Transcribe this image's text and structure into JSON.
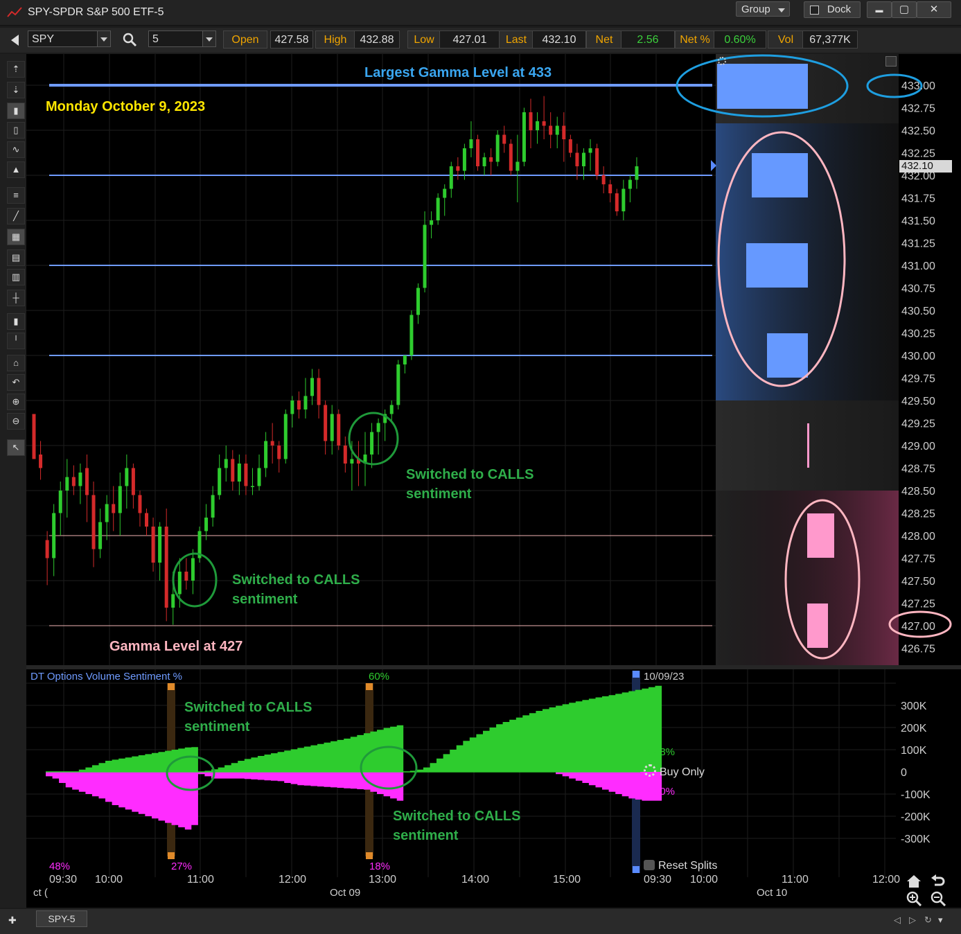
{
  "window": {
    "title": "SPY-SPDR S&P 500 ETF-5",
    "group_label": "Group",
    "dock_label": "Dock",
    "minimize_glyph": "▬",
    "maximize_glyph": "▢",
    "close_glyph": "✕"
  },
  "toolbar": {
    "symbol": "SPY",
    "interval": "5",
    "quote": [
      {
        "label": "Open",
        "value": "427.58"
      },
      {
        "label": "High",
        "value": "432.88"
      },
      {
        "label": "Low",
        "value": "427.01"
      },
      {
        "label": "Last",
        "value": "432.10"
      },
      {
        "label": "Net",
        "value": "2.56"
      },
      {
        "label": "Net %",
        "value": "0.60%"
      },
      {
        "label": "Vol",
        "value": "67,377K"
      }
    ]
  },
  "left_tools": [
    "cursor-icon",
    "crosshair-icon",
    "candle-icon",
    "bar-icon",
    "line-icon",
    "mountain-icon",
    "hline-icon",
    "trendline-icon",
    "grid-icon",
    "table-icon",
    "table2-icon",
    "vline-icon",
    "plus-bar-icon",
    "minus-bar-icon",
    "home-icon",
    "undo-icon",
    "zoom-in-icon",
    "zoom-out-icon",
    "pointer-icon"
  ],
  "main_chart": {
    "annotations": {
      "largest_gamma": "Largest Gamma Level at 433",
      "date": "Monday October 9, 2023",
      "calls_1_line1": "Switched to CALLS",
      "calls_1_line2": "sentiment",
      "calls_2_line1": "Switched to CALLS",
      "calls_2_line2": "sentiment",
      "gamma_427": "Gamma Level at 427"
    },
    "last_price_label": "432.10",
    "price_ticks": [
      "433.00",
      "432.75",
      "432.50",
      "432.25",
      "432.00",
      "431.75",
      "431.50",
      "431.25",
      "431.00",
      "430.75",
      "430.50",
      "430.25",
      "430.00",
      "429.75",
      "429.50",
      "429.25",
      "429.00",
      "428.75",
      "428.50",
      "428.25",
      "428.00",
      "427.75",
      "427.50",
      "427.25",
      "427.00",
      "426.75"
    ],
    "gamma_lines": {
      "blue": [
        433.0,
        432.0,
        431.0,
        430.0
      ],
      "pink": [
        428.0,
        427.0
      ]
    },
    "colors": {
      "up": "#2ecc2e",
      "down": "#d42a2a",
      "blue_line": "#6f9bff",
      "pink_line": "#f2b5b5",
      "gamma_blue": "#6699ff",
      "gamma_pink": "#ff99cc"
    }
  },
  "chart_data": [
    {
      "type": "candlestick",
      "title": "SPY-SPDR S&P 500 ETF-5",
      "ylim": [
        426.625,
        433.3
      ],
      "ohlc": [
        [
          429.35,
          429.35,
          428.85,
          428.85
        ],
        [
          428.9,
          429.05,
          428.62,
          428.75
        ],
        [
          427.95,
          428.05,
          427.45,
          427.75
        ],
        [
          427.75,
          428.35,
          427.55,
          428.25
        ],
        [
          428.25,
          428.6,
          428.0,
          428.5
        ],
        [
          428.5,
          428.85,
          428.2,
          428.65
        ],
        [
          428.65,
          428.78,
          428.45,
          428.55
        ],
        [
          428.55,
          428.8,
          428.35,
          428.7
        ],
        [
          428.75,
          428.9,
          428.15,
          428.45
        ],
        [
          428.45,
          428.6,
          427.65,
          427.85
        ],
        [
          427.85,
          428.3,
          427.75,
          428.15
        ],
        [
          428.15,
          428.45,
          427.95,
          428.35
        ],
        [
          428.35,
          428.55,
          428.05,
          428.25
        ],
        [
          428.25,
          428.7,
          428.0,
          428.55
        ],
        [
          428.55,
          428.9,
          428.3,
          428.75
        ],
        [
          428.75,
          428.8,
          428.3,
          428.45
        ],
        [
          428.45,
          428.5,
          428.1,
          428.25
        ],
        [
          428.25,
          428.3,
          428.0,
          428.1
        ],
        [
          428.1,
          428.2,
          427.6,
          427.7
        ],
        [
          427.7,
          428.15,
          427.5,
          428.1
        ],
        [
          428.1,
          428.3,
          427.05,
          427.2
        ],
        [
          427.2,
          427.6,
          427.01,
          427.35
        ],
        [
          427.35,
          427.75,
          427.2,
          427.6
        ],
        [
          427.6,
          427.75,
          427.4,
          427.5
        ],
        [
          427.5,
          427.85,
          427.35,
          427.75
        ],
        [
          427.75,
          428.1,
          427.7,
          428.05
        ],
        [
          428.05,
          428.35,
          427.95,
          428.2
        ],
        [
          428.2,
          428.55,
          428.1,
          428.45
        ],
        [
          428.45,
          428.9,
          428.4,
          428.75
        ],
        [
          428.75,
          429.0,
          428.6,
          428.85
        ],
        [
          428.85,
          428.95,
          428.5,
          428.6
        ],
        [
          428.6,
          428.9,
          428.45,
          428.8
        ],
        [
          428.8,
          428.9,
          428.45,
          428.55
        ],
        [
          428.55,
          428.75,
          428.45,
          428.55
        ],
        [
          428.55,
          428.9,
          428.5,
          428.75
        ],
        [
          428.75,
          429.15,
          428.65,
          429.05
        ],
        [
          429.05,
          429.25,
          428.8,
          429.0
        ],
        [
          429.0,
          429.05,
          428.7,
          428.85
        ],
        [
          428.85,
          429.4,
          428.8,
          429.35
        ],
        [
          429.35,
          429.55,
          429.2,
          429.5
        ],
        [
          429.5,
          429.6,
          429.3,
          429.4
        ],
        [
          429.4,
          429.75,
          429.3,
          429.55
        ],
        [
          429.55,
          429.85,
          429.45,
          429.75
        ],
        [
          429.75,
          429.85,
          429.3,
          429.45
        ],
        [
          429.45,
          429.5,
          428.9,
          429.05
        ],
        [
          429.05,
          429.45,
          428.9,
          429.35
        ],
        [
          429.35,
          429.4,
          428.95,
          429.0
        ],
        [
          429.0,
          429.1,
          428.7,
          428.8
        ],
        [
          428.8,
          429.05,
          428.5,
          428.85
        ],
        [
          428.85,
          429.05,
          428.55,
          428.8
        ],
        [
          428.8,
          429.15,
          428.55,
          428.9
        ],
        [
          428.9,
          429.25,
          428.75,
          429.15
        ],
        [
          429.15,
          429.3,
          428.9,
          429.25
        ],
        [
          429.25,
          429.4,
          429.05,
          429.35
        ],
        [
          429.35,
          429.5,
          429.25,
          429.45
        ],
        [
          429.45,
          429.95,
          429.4,
          429.9
        ],
        [
          429.9,
          430.0,
          429.8,
          430.0
        ],
        [
          430.0,
          430.5,
          429.95,
          430.45
        ],
        [
          430.45,
          430.8,
          430.35,
          430.75
        ],
        [
          430.75,
          431.6,
          430.7,
          431.45
        ],
        [
          431.45,
          431.6,
          431.3,
          431.5
        ],
        [
          431.5,
          431.8,
          431.45,
          431.75
        ],
        [
          431.75,
          431.9,
          431.55,
          431.85
        ],
        [
          431.85,
          432.15,
          431.75,
          432.1
        ],
        [
          432.1,
          432.2,
          431.95,
          432.05
        ],
        [
          432.05,
          432.35,
          431.95,
          432.3
        ],
        [
          432.3,
          432.6,
          432.2,
          432.4
        ],
        [
          432.4,
          432.45,
          432.05,
          432.1
        ],
        [
          432.1,
          432.25,
          432.0,
          432.2
        ],
        [
          432.2,
          432.3,
          432.0,
          432.15
        ],
        [
          432.15,
          432.5,
          432.1,
          432.45
        ],
        [
          432.45,
          432.55,
          432.25,
          432.35
        ],
        [
          432.35,
          432.4,
          432.0,
          432.05
        ],
        [
          432.05,
          432.45,
          431.7,
          432.15
        ],
        [
          432.15,
          432.75,
          432.1,
          432.7
        ],
        [
          432.7,
          432.85,
          432.3,
          432.5
        ],
        [
          432.5,
          432.7,
          432.35,
          432.6
        ],
        [
          432.6,
          432.88,
          432.4,
          432.55
        ],
        [
          432.55,
          432.7,
          432.3,
          432.45
        ],
        [
          432.45,
          432.65,
          432.3,
          432.55
        ],
        [
          432.55,
          432.7,
          432.15,
          432.4
        ],
        [
          432.4,
          432.45,
          432.2,
          432.25
        ],
        [
          432.25,
          432.35,
          431.95,
          432.1
        ],
        [
          432.1,
          432.3,
          431.95,
          432.25
        ],
        [
          432.25,
          432.4,
          432.05,
          432.3
        ],
        [
          432.3,
          432.35,
          431.95,
          432.0
        ],
        [
          432.0,
          432.1,
          431.8,
          431.9
        ],
        [
          431.9,
          431.95,
          431.7,
          431.8
        ],
        [
          431.8,
          431.85,
          431.55,
          431.6
        ],
        [
          431.6,
          431.95,
          431.5,
          431.85
        ],
        [
          431.85,
          432.0,
          431.7,
          431.95
        ],
        [
          431.95,
          432.2,
          431.85,
          432.1
        ]
      ]
    },
    {
      "type": "area",
      "title": "DT Options Volume Sentiment %",
      "ylim": [
        -350000,
        350000
      ],
      "yticks": [
        "300K",
        "200K",
        "100K",
        "0",
        "-100K",
        "-200K",
        "-300K"
      ],
      "series": [
        {
          "name": "B-48%",
          "color": "#2ecc2e",
          "values": [
            0,
            0,
            0,
            0,
            0,
            10000,
            20000,
            30000,
            40000,
            50000,
            55000,
            60000,
            65000,
            70000,
            75000,
            80000,
            85000,
            90000,
            95000,
            100000,
            105000,
            110000,
            112000,
            0,
            5000,
            12000,
            20000,
            30000,
            40000,
            50000,
            58000,
            65000,
            72000,
            78000,
            84000,
            90000,
            96000,
            102000,
            108000,
            114000,
            120000,
            126000,
            132000,
            138000,
            144000,
            150000,
            158000,
            166000,
            174000,
            182000,
            190000,
            198000,
            204000,
            210000,
            0,
            5000,
            10000,
            20000,
            40000,
            60000,
            80000,
            100000,
            120000,
            140000,
            155000,
            170000,
            185000,
            200000,
            215000,
            225000,
            235000,
            245000,
            255000,
            265000,
            275000,
            283000,
            291000,
            298000,
            305000,
            312000,
            318000,
            324000,
            330000,
            336000,
            341000,
            346000,
            352000,
            358000,
            364000,
            370000,
            376000,
            382000,
            388000
          ]
        },
        {
          "name": "B-30%",
          "color": "#ff2cff",
          "values": [
            -20000,
            -30000,
            -50000,
            -70000,
            -80000,
            -90000,
            -100000,
            -110000,
            -120000,
            -135000,
            -150000,
            -160000,
            -170000,
            -180000,
            -190000,
            -200000,
            -210000,
            -220000,
            -230000,
            -240000,
            -250000,
            -260000,
            -240000,
            -10000,
            -20000,
            -30000,
            -30000,
            -30000,
            -30000,
            -30000,
            -32000,
            -34000,
            -36000,
            -38000,
            -40000,
            -42000,
            -50000,
            -55000,
            -60000,
            -62000,
            -64000,
            -66000,
            -68000,
            -70000,
            -72000,
            -74000,
            -76000,
            -78000,
            -80000,
            -90000,
            -100000,
            -110000,
            -120000,
            -130000,
            0,
            0,
            0,
            0,
            0,
            0,
            0,
            0,
            0,
            0,
            0,
            0,
            0,
            0,
            0,
            0,
            0,
            0,
            0,
            0,
            0,
            0,
            0,
            -10000,
            -20000,
            -30000,
            -40000,
            -50000,
            -60000,
            -70000,
            -80000,
            -90000,
            -100000,
            -110000,
            -120000,
            -125000,
            -130000,
            -130000,
            -130000
          ]
        }
      ]
    }
  ],
  "sub_chart": {
    "title": "DT Options Volume Sentiment %",
    "right_date": "10/09/23",
    "pct_labels": [
      {
        "text": "48%",
        "color": "#ff2cff"
      },
      {
        "text": "27%",
        "color": "#ff2cff"
      },
      {
        "text": "60%",
        "color": "#2ecc2e"
      },
      {
        "text": "18%",
        "color": "#ff2cff"
      }
    ],
    "b_green": "B-48%",
    "b_pink": "B-30%",
    "buy_only": "Buy Only",
    "reset_splits": "Reset Splits",
    "annotations": {
      "calls_a_line1": "Switched to CALLS",
      "calls_a_line2": "sentiment",
      "calls_b_line1": "Switched to CALLS",
      "calls_b_line2": "sentiment"
    }
  },
  "time_axis": {
    "labels": [
      "09:30",
      "10:00",
      "11:00",
      "12:00",
      "13:00",
      "14:00",
      "15:00",
      "09:30",
      "10:00",
      "11:00",
      "12:00"
    ],
    "date_labels": [
      "ct (",
      "Oct 09",
      "Oct 10"
    ]
  },
  "bottom": {
    "tab": "SPY-5",
    "add": "✚"
  }
}
